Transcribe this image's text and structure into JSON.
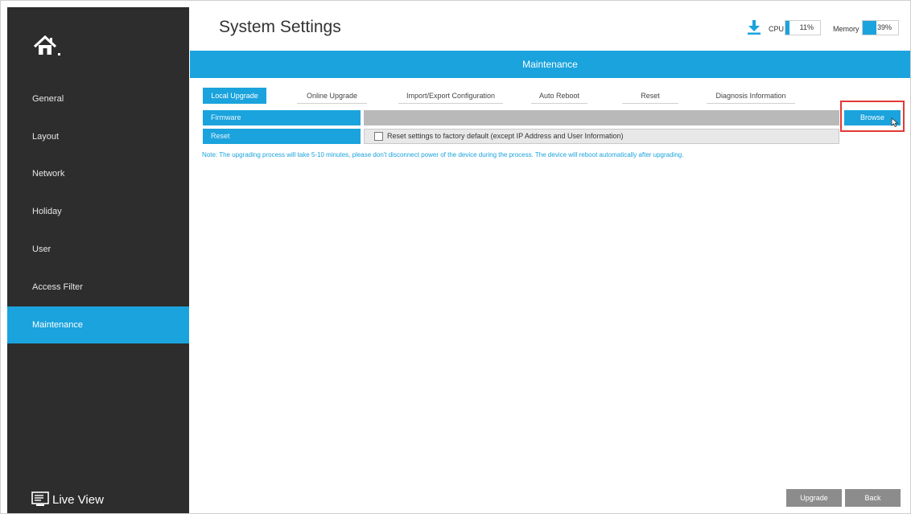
{
  "sidebar": {
    "items": [
      {
        "label": "General"
      },
      {
        "label": "Layout"
      },
      {
        "label": "Network"
      },
      {
        "label": "Holiday"
      },
      {
        "label": "User"
      },
      {
        "label": "Access Filter"
      },
      {
        "label": "Maintenance",
        "active": true
      }
    ],
    "live_view": "Live View"
  },
  "header": {
    "title": "System Settings",
    "cpu_label": "CPU",
    "cpu_value": "11%",
    "memory_label": "Memory",
    "memory_value": "39%",
    "cpu_fraction": 0.11,
    "memory_fraction": 0.39
  },
  "banner": "Maintenance",
  "tabs": [
    {
      "label": "Local Upgrade",
      "active": true
    },
    {
      "label": "Online Upgrade"
    },
    {
      "label": "Import/Export Configuration"
    },
    {
      "label": "Auto Reboot"
    },
    {
      "label": "Reset"
    },
    {
      "label": "Diagnosis Information"
    }
  ],
  "form": {
    "firmware_label": "Firmware",
    "firmware_value": "",
    "browse_label": "Browse",
    "reset_label": "Reset",
    "reset_checkbox_text": "Reset settings to factory default (except IP Address and User Information)",
    "note": "Note: The upgrading process will take 5-10 minutes, please don't disconnect power of the device during the process. The device will reboot automatically after upgrading."
  },
  "footer": {
    "upgrade_label": "Upgrade",
    "back_label": "Back"
  },
  "colors": {
    "accent": "#1aa3dd",
    "sidebar_bg": "#2d2d2d",
    "highlight": "#e53935"
  }
}
